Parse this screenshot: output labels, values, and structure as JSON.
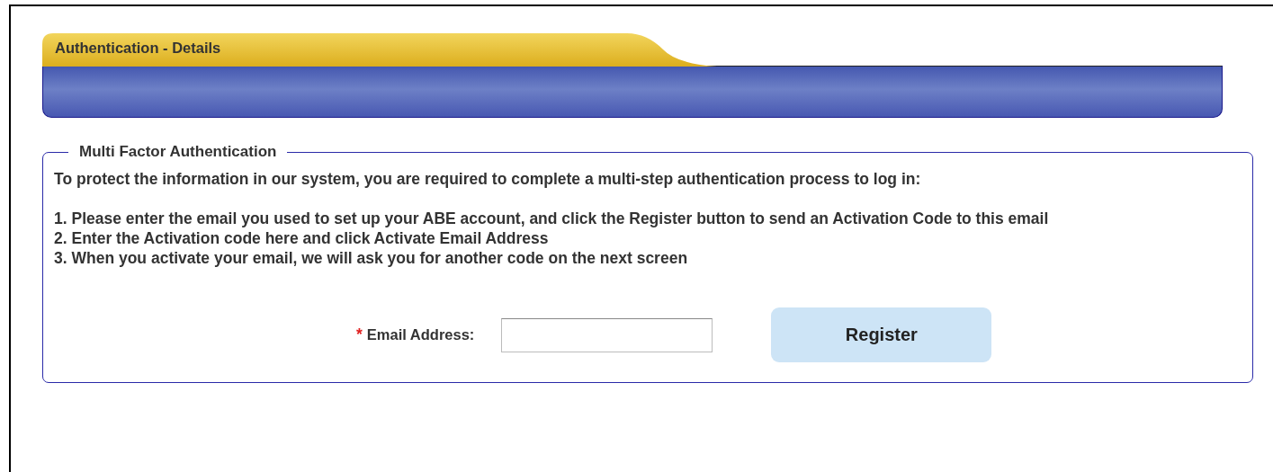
{
  "header": {
    "tab_title": "Authentication - Details"
  },
  "section": {
    "legend": "Multi Factor Authentication",
    "intro": "To protect the information in our system, you are required to complete a multi-step authentication process to log in:",
    "steps": [
      "1. Please enter the email you used to set up your ABE account, and click the Register button to send an Activation Code to this email",
      "2. Enter the Activation code here and click Activate Email Address",
      "3. When you activate your email, we will ask you for another code on the next screen"
    ],
    "form": {
      "required_mark": "*",
      "label": "Email Address:",
      "button": "Register"
    }
  }
}
